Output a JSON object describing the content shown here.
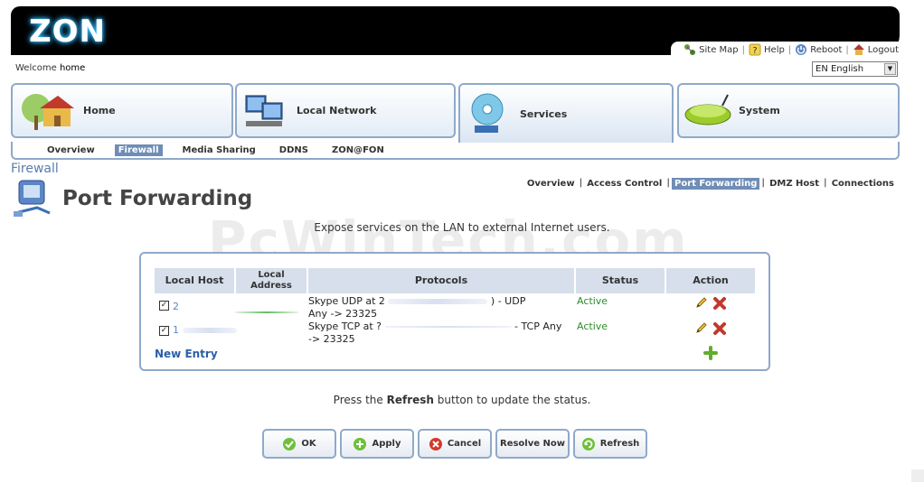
{
  "brand": {
    "logo_text": "ZON",
    "accent": "#8fa9c9",
    "active_tab_color": "#6f8db5",
    "status_active_color": "#2e8b2e"
  },
  "top_links": [
    {
      "label": "Site Map",
      "icon": "sitemap-icon"
    },
    {
      "label": "Help",
      "icon": "help-icon"
    },
    {
      "label": "Reboot",
      "icon": "power-icon"
    },
    {
      "label": "Logout",
      "icon": "house-logout-icon"
    }
  ],
  "welcome": {
    "prefix": "Welcome",
    "user": "home"
  },
  "language": {
    "selected": "EN English"
  },
  "main_tabs": [
    {
      "label": "Home",
      "icon": "house-tree-icon",
      "active": false
    },
    {
      "label": "Local Network",
      "icon": "computers-icon",
      "active": false
    },
    {
      "label": "Services",
      "icon": "disc-icon",
      "active": true
    },
    {
      "label": "System",
      "icon": "router-icon",
      "active": false
    }
  ],
  "sub_nav": [
    {
      "label": "Overview",
      "active": false
    },
    {
      "label": "Firewall",
      "active": true
    },
    {
      "label": "Media Sharing",
      "active": false
    },
    {
      "label": "DDNS",
      "active": false
    },
    {
      "label": "ZON@FON",
      "active": false
    }
  ],
  "section_title": "Firewall",
  "page_title": "Port Forwarding",
  "right_nav": [
    {
      "label": "Overview",
      "active": false
    },
    {
      "label": "Access Control",
      "active": false
    },
    {
      "label": "Port Forwarding",
      "active": true
    },
    {
      "label": "DMZ Host",
      "active": false
    },
    {
      "label": "Connections",
      "active": false
    }
  ],
  "watermark": "PcWinTech.com",
  "description": "Expose services on the LAN to external Internet users.",
  "table": {
    "headers": {
      "local_host": "Local Host",
      "local_address": "Local Address",
      "protocols": "Protocols",
      "status": "Status",
      "action": "Action"
    },
    "rows": [
      {
        "checked": "✓",
        "host_prefix": "2",
        "protocol_line1": "Skype UDP at 2",
        "protocol_tail": ") - UDP",
        "protocol_line2": "Any -> 23325",
        "status": "Active"
      },
      {
        "checked": "✓",
        "host_prefix": "1",
        "protocol_line1": "Skype TCP at ?",
        "protocol_tail": "- TCP Any",
        "protocol_line2": "-> 23325",
        "status": "Active"
      }
    ],
    "new_entry": "New Entry"
  },
  "footnote": {
    "before": "Press the",
    "bold": "Refresh",
    "after": "button to update the status."
  },
  "buttons": [
    {
      "label": "OK",
      "icon": "check-circle-icon"
    },
    {
      "label": "Apply",
      "icon": "apply-circle-icon"
    },
    {
      "label": "Cancel",
      "icon": "cancel-circle-icon"
    },
    {
      "label": "Resolve Now",
      "icon": ""
    },
    {
      "label": "Refresh",
      "icon": "refresh-circle-icon"
    }
  ]
}
